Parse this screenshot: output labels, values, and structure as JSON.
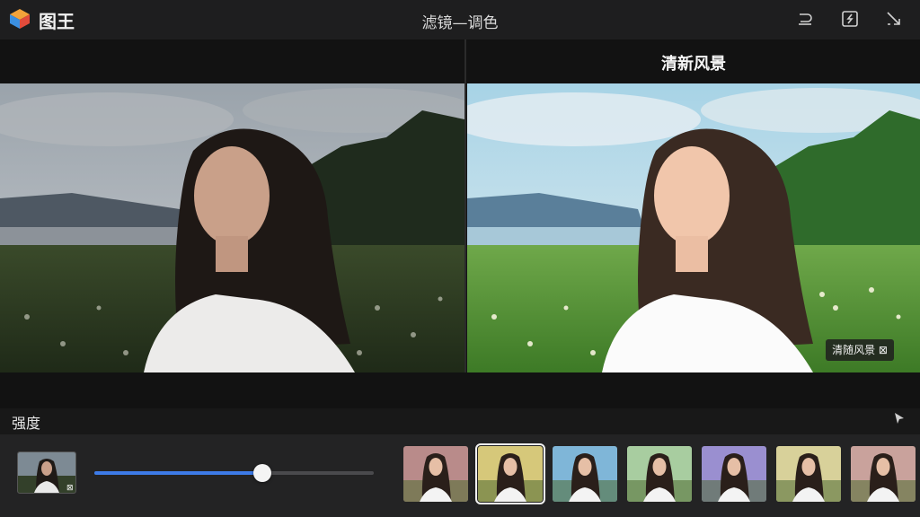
{
  "app": {
    "name": "图王",
    "window_title": "滤镜—调色"
  },
  "toolbar": {
    "icons": [
      "undo-icon",
      "compare-icon",
      "collapse-icon"
    ]
  },
  "preview": {
    "filter_label": "清新风景",
    "badge": "清随风景 ⊠",
    "original_icon": "photo-original",
    "filtered_icon": "photo-filtered"
  },
  "strength": {
    "label": "强度",
    "value": 0.6
  },
  "current_thumb_caption": "⊠",
  "presets": [
    {
      "name": "preset-1",
      "tint": "#b98b8a",
      "selected": false
    },
    {
      "name": "preset-2",
      "tint": "#d6c87a",
      "selected": true
    },
    {
      "name": "preset-3",
      "tint": "#7fb6d8",
      "selected": false
    },
    {
      "name": "preset-4",
      "tint": "#a8cda0",
      "selected": false
    },
    {
      "name": "preset-5",
      "tint": "#9a8fd0",
      "selected": false
    },
    {
      "name": "preset-6",
      "tint": "#d8d19a",
      "selected": false
    },
    {
      "name": "preset-7",
      "tint": "#c9a29c",
      "selected": false
    }
  ],
  "colors": {
    "accent": "#3d7be8",
    "background": "#141414"
  }
}
